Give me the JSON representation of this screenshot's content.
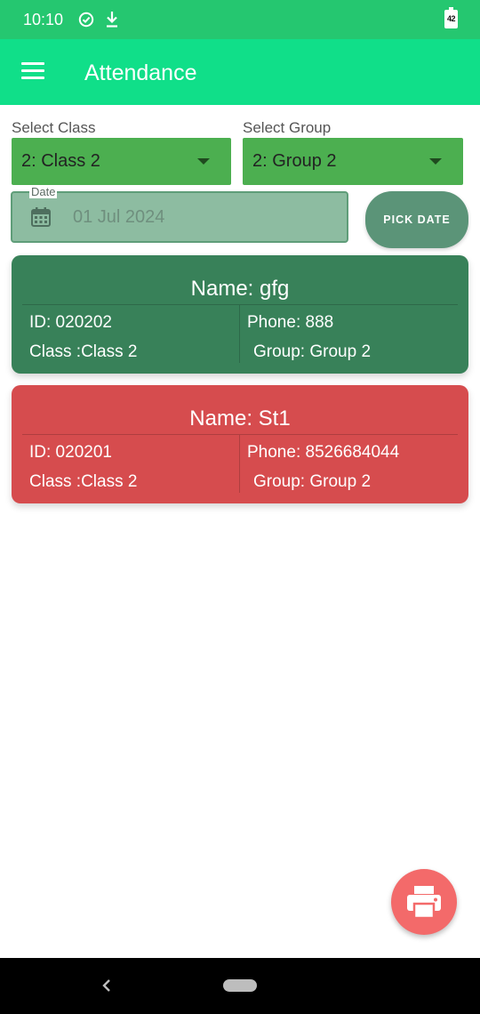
{
  "status_bar": {
    "time": "10:10",
    "battery_level": "42",
    "icons": [
      "check-circle-icon",
      "download-icon",
      "battery-icon"
    ]
  },
  "app_bar": {
    "title": "Attendance",
    "menu_icon": "menu-icon"
  },
  "filters": {
    "class": {
      "label": "Select Class",
      "value": "2: Class 2"
    },
    "group": {
      "label": "Select Group",
      "value": "2: Group 2"
    }
  },
  "date_field": {
    "label": "Date",
    "value": "01 Jul 2024",
    "icon": "calendar-icon",
    "pick_button": "PICK DATE"
  },
  "students": [
    {
      "name": "Name: gfg",
      "id": "ID: 020202",
      "phone": "Phone: 888",
      "class": "Class :Class 2",
      "group": "Group: Group 2",
      "color": "#388159"
    },
    {
      "name": "Name: St1",
      "id": "ID: 020201",
      "phone": "Phone: 8526684044",
      "class": "Class :Class 2",
      "group": "Group: Group 2",
      "color": "#d64c4e"
    }
  ],
  "fab": {
    "icon": "print-icon",
    "color": "#f36a6a"
  },
  "colors": {
    "status_bar": "#25c770",
    "app_bar": "#10df89",
    "select_box": "#4caf50",
    "pick_date_button": "#5b9478"
  }
}
